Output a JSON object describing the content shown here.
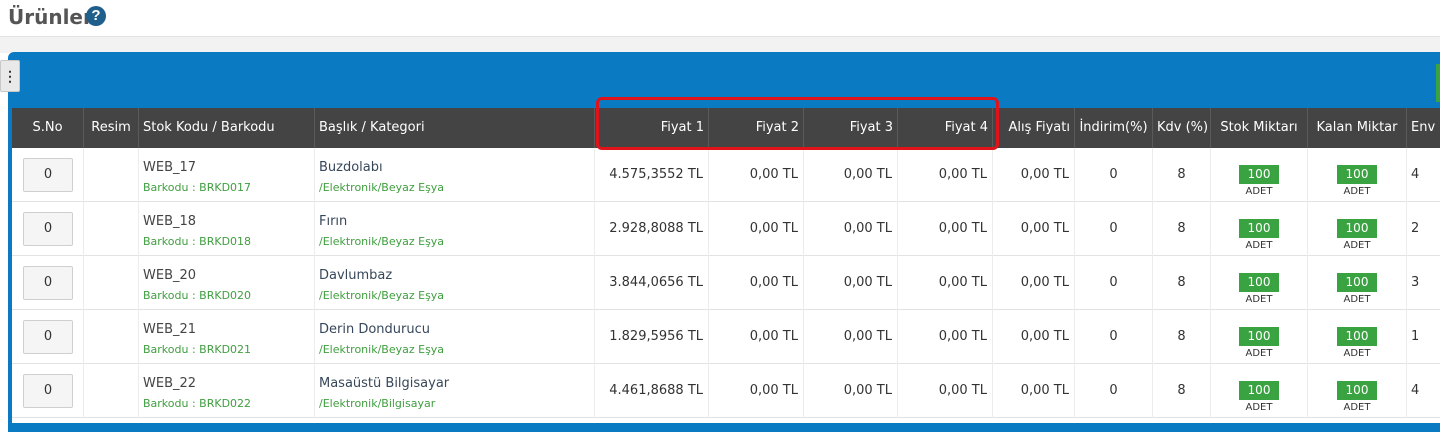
{
  "page": {
    "title": "Ürünler",
    "help_icon": "question-circle-icon"
  },
  "colors": {
    "panel": "#0a7bc2",
    "header_bg": "#444444",
    "badge": "#3aa341",
    "highlight": "#e0121a",
    "subtext": "#3f9e3f"
  },
  "table": {
    "headers": {
      "sno": "S.No",
      "resim": "Resim",
      "stok_kodu": "Stok Kodu / Barkodu",
      "baslik": "Başlık / Kategori",
      "fiyat1": "Fiyat 1",
      "fiyat2": "Fiyat 2",
      "fiyat3": "Fiyat 3",
      "fiyat4": "Fiyat 4",
      "alis": "Alış Fiyatı",
      "indirim": "İndirim(%)",
      "kdv": "Kdv (%)",
      "stok": "Stok Miktarı",
      "kalan": "Kalan Miktar",
      "env": "Env"
    },
    "rows": [
      {
        "sno": "0",
        "code": "WEB_17",
        "barcode": "Barkodu : BRKD017",
        "title": "Buzdolabı",
        "category": "/Elektronik/Beyaz Eşya",
        "fiyat1": "4.575,3552 TL",
        "fiyat2": "0,00 TL",
        "fiyat3": "0,00 TL",
        "fiyat4": "0,00 TL",
        "alis": "0,00 TL",
        "indirim": "0",
        "kdv": "8",
        "stok": "100",
        "stok_unit": "ADET",
        "kalan": "100",
        "kalan_unit": "ADET",
        "env": "4"
      },
      {
        "sno": "0",
        "code": "WEB_18",
        "barcode": "Barkodu : BRKD018",
        "title": "Fırın",
        "category": "/Elektronik/Beyaz Eşya",
        "fiyat1": "2.928,8088 TL",
        "fiyat2": "0,00 TL",
        "fiyat3": "0,00 TL",
        "fiyat4": "0,00 TL",
        "alis": "0,00 TL",
        "indirim": "0",
        "kdv": "8",
        "stok": "100",
        "stok_unit": "ADET",
        "kalan": "100",
        "kalan_unit": "ADET",
        "env": "2"
      },
      {
        "sno": "0",
        "code": "WEB_20",
        "barcode": "Barkodu : BRKD020",
        "title": "Davlumbaz",
        "category": "/Elektronik/Beyaz Eşya",
        "fiyat1": "3.844,0656 TL",
        "fiyat2": "0,00 TL",
        "fiyat3": "0,00 TL",
        "fiyat4": "0,00 TL",
        "alis": "0,00 TL",
        "indirim": "0",
        "kdv": "8",
        "stok": "100",
        "stok_unit": "ADET",
        "kalan": "100",
        "kalan_unit": "ADET",
        "env": "3"
      },
      {
        "sno": "0",
        "code": "WEB_21",
        "barcode": "Barkodu : BRKD021",
        "title": "Derin Dondurucu",
        "category": "/Elektronik/Beyaz Eşya",
        "fiyat1": "1.829,5956 TL",
        "fiyat2": "0,00 TL",
        "fiyat3": "0,00 TL",
        "fiyat4": "0,00 TL",
        "alis": "0,00 TL",
        "indirim": "0",
        "kdv": "8",
        "stok": "100",
        "stok_unit": "ADET",
        "kalan": "100",
        "kalan_unit": "ADET",
        "env": "1"
      },
      {
        "sno": "0",
        "code": "WEB_22",
        "barcode": "Barkodu : BRKD022",
        "title": "Masaüstü Bilgisayar",
        "category": "/Elektronik/Bilgisayar",
        "fiyat1": "4.461,8688 TL",
        "fiyat2": "0,00 TL",
        "fiyat3": "0,00 TL",
        "fiyat4": "0,00 TL",
        "alis": "0,00 TL",
        "indirim": "0",
        "kdv": "8",
        "stok": "100",
        "stok_unit": "ADET",
        "kalan": "100",
        "kalan_unit": "ADET",
        "env": "4"
      }
    ]
  }
}
